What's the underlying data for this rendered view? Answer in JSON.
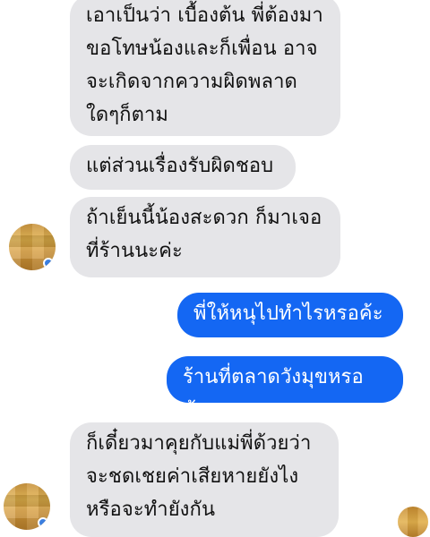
{
  "messages": {
    "incoming_1": "เอาเป็นว่า เบื้องต้น พี่ต้องมา\nขอโทษน้องและก็เพื่อน อาจ\nจะเกิดจากความผิดพลาด\nใดๆก็ตาม",
    "incoming_2": "แต่ส่วนเรื่องรับผิดชอบ",
    "incoming_3": "ถ้าเย็นนี้น้องสะดวก ก็มาเจอ\nที่ร้านนะค่ะ",
    "outgoing_1": "พี่ให้หนุไปทำไรหรอค้ะ",
    "outgoing_2": "ร้านที่ตลาดวังมุขหรอค้ะ",
    "incoming_4": "ก็เดี๋ยวมาคุยกับแม่พี่ด้วยว่า\nจะชดเชยค่าเสียหายยังไง\nหรือจะทำยังกัน"
  },
  "colors": {
    "incoming_bubble": "#e5e5e8",
    "outgoing_bubble": "#1467f3"
  }
}
